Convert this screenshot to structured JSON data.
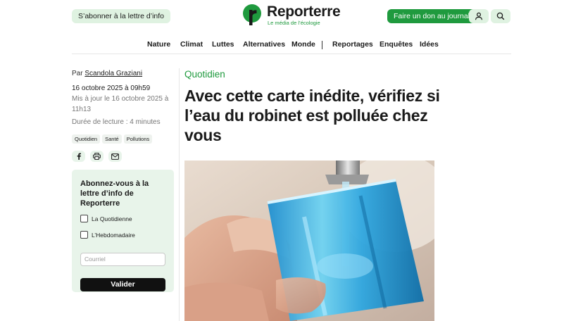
{
  "header": {
    "subscribe_label": "S’abonner à la lettre d’info",
    "logo_name": "Reporterre",
    "logo_tagline": "Le média de l’écologie",
    "donate_label": "Faire un don au journal",
    "user_icon": "user-icon",
    "search_icon": "search-icon"
  },
  "nav": {
    "items": [
      "Nature",
      "Climat",
      "Luttes",
      "Alternatives",
      "Monde",
      "Reportages",
      "Enquêtes",
      "Idées"
    ]
  },
  "article": {
    "byline_prefix": "Par",
    "author": "Scandola Graziani",
    "published": "16 octobre 2025 à 09h59",
    "updated": "Mis à jour le 16 octobre 2025 à 11h13",
    "reading_time": "Durée de lecture : 4 minutes",
    "tags": [
      "Quotidien",
      "Santé",
      "Pollutions"
    ],
    "category": "Quotidien",
    "title": "Avec cette carte inédite, vérifiez si l’eau du robinet est polluée chez vous"
  },
  "share": {
    "icons": [
      "facebook-icon",
      "print-icon",
      "email-icon"
    ]
  },
  "newsletter": {
    "title": "Abonnez-vous à la lettre d’info de Reporterre",
    "option_daily": "La Quotidienne",
    "option_weekly": "L’Hebdomadaire",
    "email_placeholder": "Courriel",
    "submit_label": "Valider"
  },
  "colors": {
    "brand_green": "#1f9a3e",
    "light_green": "#dff2e1",
    "panel_green": "#e8f4ea"
  }
}
